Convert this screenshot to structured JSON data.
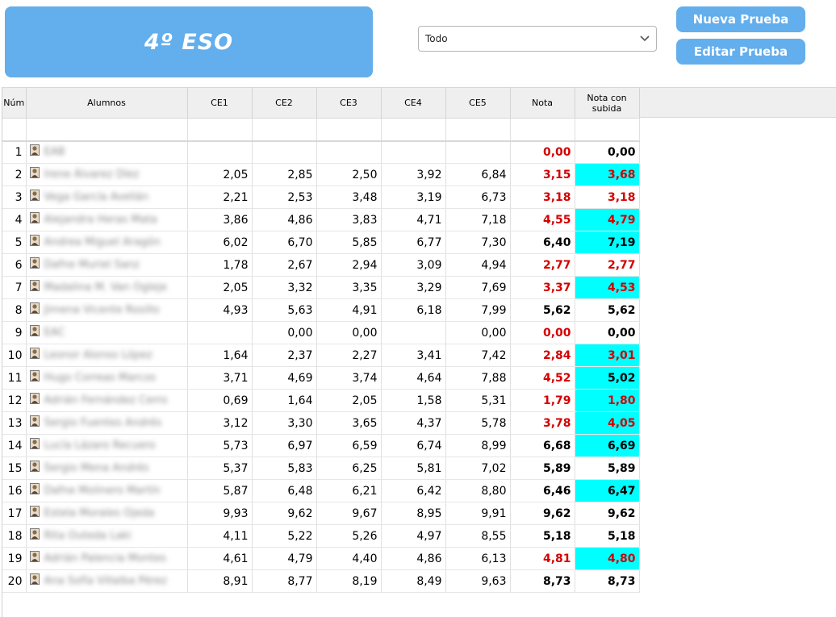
{
  "header": {
    "title": "4º ESO",
    "filter_value": "Todo",
    "new_test_label": "Nueva Prueba",
    "edit_test_label": "Editar Prueba"
  },
  "colors": {
    "accent": "#63aeec",
    "highlight": "#00ffff",
    "fail_red": "#d40000"
  },
  "icons": {
    "dropdown": "chevron-down-icon",
    "student_photo": "student-photo-icon"
  },
  "table": {
    "columns": [
      "Núm",
      "Alumnos",
      "CE1",
      "CE2",
      "CE3",
      "CE4",
      "CE5",
      "Nota",
      "Nota con subida"
    ],
    "rows": [
      {
        "n": "1",
        "name": "EAB",
        "ce1": "",
        "ce2": "",
        "ce3": "",
        "ce4": "",
        "ce5": "",
        "nota": "0,00",
        "nota_red": true,
        "sub": "0,00",
        "sub_red": false,
        "sub_hl": false
      },
      {
        "n": "2",
        "name": "Irene Álvarez Díez",
        "ce1": "2,05",
        "ce2": "2,85",
        "ce3": "2,50",
        "ce4": "3,92",
        "ce5": "6,84",
        "nota": "3,15",
        "nota_red": true,
        "sub": "3,68",
        "sub_red": true,
        "sub_hl": true
      },
      {
        "n": "3",
        "name": "Vega García Avellán",
        "ce1": "2,21",
        "ce2": "2,53",
        "ce3": "3,48",
        "ce4": "3,19",
        "ce5": "6,73",
        "nota": "3,18",
        "nota_red": true,
        "sub": "3,18",
        "sub_red": true,
        "sub_hl": false
      },
      {
        "n": "4",
        "name": "Alejandra Heras Mata",
        "ce1": "3,86",
        "ce2": "4,86",
        "ce3": "3,83",
        "ce4": "4,71",
        "ce5": "7,18",
        "nota": "4,55",
        "nota_red": true,
        "sub": "4,79",
        "sub_red": true,
        "sub_hl": true
      },
      {
        "n": "5",
        "name": "Andrea Miguel Aragón",
        "ce1": "6,02",
        "ce2": "6,70",
        "ce3": "5,85",
        "ce4": "6,77",
        "ce5": "7,30",
        "nota": "6,40",
        "nota_red": false,
        "sub": "7,19",
        "sub_red": false,
        "sub_hl": true
      },
      {
        "n": "6",
        "name": "Dafne Muriel Sanz",
        "ce1": "1,78",
        "ce2": "2,67",
        "ce3": "2,94",
        "ce4": "3,09",
        "ce5": "4,94",
        "nota": "2,77",
        "nota_red": true,
        "sub": "2,77",
        "sub_red": true,
        "sub_hl": false
      },
      {
        "n": "7",
        "name": "Madalina M. Van Ogleje",
        "ce1": "2,05",
        "ce2": "3,32",
        "ce3": "3,35",
        "ce4": "3,29",
        "ce5": "7,69",
        "nota": "3,37",
        "nota_red": true,
        "sub": "4,53",
        "sub_red": true,
        "sub_hl": true
      },
      {
        "n": "8",
        "name": "Jimena Vicente Rosillo",
        "ce1": "4,93",
        "ce2": "5,63",
        "ce3": "4,91",
        "ce4": "6,18",
        "ce5": "7,99",
        "nota": "5,62",
        "nota_red": false,
        "sub": "5,62",
        "sub_red": false,
        "sub_hl": false
      },
      {
        "n": "9",
        "name": "EAC",
        "ce1": "",
        "ce2": "0,00",
        "ce3": "0,00",
        "ce4": "",
        "ce5": "0,00",
        "nota": "0,00",
        "nota_red": true,
        "sub": "0,00",
        "sub_red": false,
        "sub_hl": false
      },
      {
        "n": "10",
        "name": "Leonor Alonso López",
        "ce1": "1,64",
        "ce2": "2,37",
        "ce3": "2,27",
        "ce4": "3,41",
        "ce5": "7,42",
        "nota": "2,84",
        "nota_red": true,
        "sub": "3,01",
        "sub_red": true,
        "sub_hl": true
      },
      {
        "n": "11",
        "name": "Hugo Correas Marcos",
        "ce1": "3,71",
        "ce2": "4,69",
        "ce3": "3,74",
        "ce4": "4,64",
        "ce5": "7,88",
        "nota": "4,52",
        "nota_red": true,
        "sub": "5,02",
        "sub_red": false,
        "sub_hl": true
      },
      {
        "n": "12",
        "name": "Adrián Fernández Cerro",
        "ce1": "0,69",
        "ce2": "1,64",
        "ce3": "2,05",
        "ce4": "1,58",
        "ce5": "5,31",
        "nota": "1,79",
        "nota_red": true,
        "sub": "1,80",
        "sub_red": true,
        "sub_hl": true
      },
      {
        "n": "13",
        "name": "Sergio Fuentes Andrés",
        "ce1": "3,12",
        "ce2": "3,30",
        "ce3": "3,65",
        "ce4": "4,37",
        "ce5": "5,78",
        "nota": "3,78",
        "nota_red": true,
        "sub": "4,05",
        "sub_red": true,
        "sub_hl": true
      },
      {
        "n": "14",
        "name": "Lucía Lázaro Recuero",
        "ce1": "5,73",
        "ce2": "6,97",
        "ce3": "6,59",
        "ce4": "6,74",
        "ce5": "8,99",
        "nota": "6,68",
        "nota_red": false,
        "sub": "6,69",
        "sub_red": false,
        "sub_hl": true
      },
      {
        "n": "15",
        "name": "Sergio Mena Andrés",
        "ce1": "5,37",
        "ce2": "5,83",
        "ce3": "6,25",
        "ce4": "5,81",
        "ce5": "7,02",
        "nota": "5,89",
        "nota_red": false,
        "sub": "5,89",
        "sub_red": false,
        "sub_hl": false
      },
      {
        "n": "16",
        "name": "Dafne Molinero Martín",
        "ce1": "5,87",
        "ce2": "6,48",
        "ce3": "6,21",
        "ce4": "6,42",
        "ce5": "8,80",
        "nota": "6,46",
        "nota_red": false,
        "sub": "6,47",
        "sub_red": false,
        "sub_hl": true
      },
      {
        "n": "17",
        "name": "Estela Morales Ojeda",
        "ce1": "9,93",
        "ce2": "9,62",
        "ce3": "9,67",
        "ce4": "8,95",
        "ce5": "9,91",
        "nota": "9,62",
        "nota_red": false,
        "sub": "9,62",
        "sub_red": false,
        "sub_hl": false
      },
      {
        "n": "18",
        "name": "Rita Outeda Laki",
        "ce1": "4,11",
        "ce2": "5,22",
        "ce3": "5,26",
        "ce4": "4,97",
        "ce5": "8,55",
        "nota": "5,18",
        "nota_red": false,
        "sub": "5,18",
        "sub_red": false,
        "sub_hl": false
      },
      {
        "n": "19",
        "name": "Adrián Palencia Montes",
        "ce1": "4,61",
        "ce2": "4,79",
        "ce3": "4,40",
        "ce4": "4,86",
        "ce5": "6,13",
        "nota": "4,81",
        "nota_red": true,
        "sub": "4,80",
        "sub_red": true,
        "sub_hl": true
      },
      {
        "n": "20",
        "name": "Ana Sofía Villalba Pérez",
        "ce1": "8,91",
        "ce2": "8,77",
        "ce3": "8,19",
        "ce4": "8,49",
        "ce5": "9,63",
        "nota": "8,73",
        "nota_red": false,
        "sub": "8,73",
        "sub_red": false,
        "sub_hl": false
      }
    ]
  }
}
